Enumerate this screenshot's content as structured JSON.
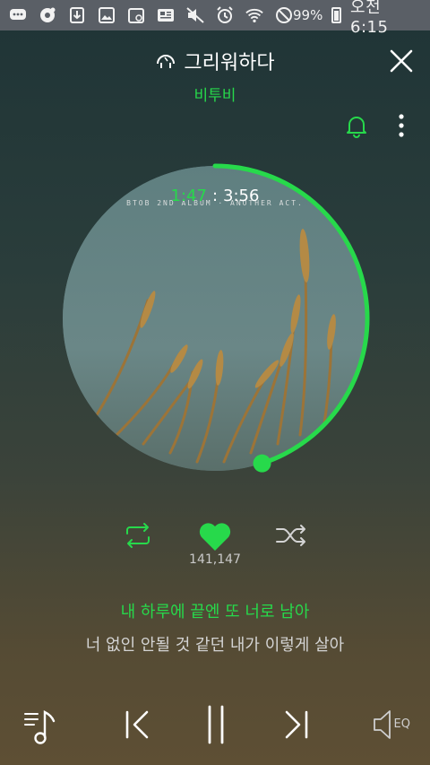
{
  "status_bar": {
    "battery": "99%",
    "time": "오전 6:15",
    "icons": [
      "chat-bubble-icon",
      "record-icon",
      "download-icon",
      "gallery-icon",
      "calendar-icon",
      "news-icon",
      "mute-icon",
      "alarm-icon",
      "wifi-icon",
      "do-not-disturb-icon",
      "battery-icon"
    ]
  },
  "header": {
    "title": "그리워하다",
    "artist": "비투비"
  },
  "player": {
    "album_caption": "BTOB 2ND ALBUM · ANOTHER ACT.",
    "current_time": "1:47",
    "separator": ":",
    "total_time": "3:56",
    "progress_fraction": 0.45
  },
  "actions": {
    "like_count": "141,147"
  },
  "lyrics": {
    "current": "내 하루에 끝엔 또 너로 남아",
    "next": "너 없인 안될 것 같던 내가 이렇게 살아"
  },
  "bottom": {
    "eq_label": "EQ"
  },
  "colors": {
    "accent": "#27d94b",
    "status_bar": "#5a5f66"
  }
}
